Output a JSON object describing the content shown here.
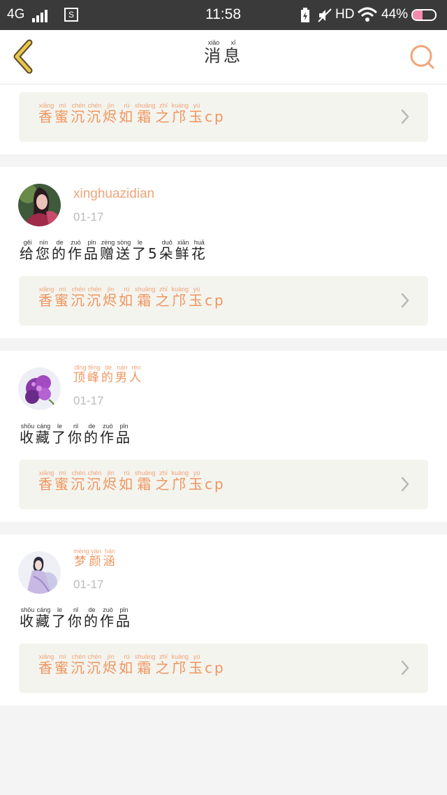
{
  "status_bar": {
    "network": "4G",
    "time": "11:58",
    "hd": "HD",
    "battery_text": "44%",
    "battery_level": 0.44
  },
  "header": {
    "title": [
      {
        "c": "消",
        "p": "xiāo"
      },
      {
        "c": "息",
        "p": "xī"
      }
    ],
    "back_icon": "chevron-left-icon",
    "search_icon": "search-icon",
    "accent_color": "#f0a478"
  },
  "colors": {
    "accent": "#f0a478",
    "work_text": "#f0955d",
    "work_bg": "#f4f4ef",
    "divider_bg": "#f4f4f4"
  },
  "messages": [
    {
      "username": "xinghuazidian",
      "username_ruby": null,
      "date": "01-17",
      "action": [
        {
          "c": "给",
          "p": "gěi"
        },
        {
          "c": "您",
          "p": "nín"
        },
        {
          "c": "的",
          "p": "de"
        },
        {
          "c": "作",
          "p": "zuò"
        },
        {
          "c": "品",
          "p": "pǐn"
        },
        {
          "c": "赠",
          "p": "zèng"
        },
        {
          "c": "送",
          "p": "sòng"
        },
        {
          "c": "了",
          "p": "le"
        },
        {
          "c": "5",
          "p": ""
        },
        {
          "c": "朵",
          "p": "duǒ"
        },
        {
          "c": "鲜",
          "p": "xiān"
        },
        {
          "c": "花",
          "p": "huā"
        }
      ],
      "work_title": [
        {
          "c": "香",
          "p": "xiāng"
        },
        {
          "c": "蜜",
          "p": "mì"
        },
        {
          "c": "沉",
          "p": "chén"
        },
        {
          "c": "沉",
          "p": "chén"
        },
        {
          "c": "烬",
          "p": "jìn"
        },
        {
          "c": "如",
          "p": "rú"
        },
        {
          "c": "霜",
          "p": "shuāng"
        },
        {
          "c": "之",
          "p": "zhī"
        },
        {
          "c": "邝",
          "p": "kuàng"
        },
        {
          "c": "玉",
          "p": "yù"
        },
        {
          "c": "cp",
          "p": ""
        }
      ],
      "avatar": "female-warrior"
    },
    {
      "username": "xinghuazidian",
      "username_ruby": null,
      "date": "01-17",
      "action": [
        {
          "c": "给",
          "p": "gěi"
        },
        {
          "c": "您",
          "p": "nín"
        },
        {
          "c": "的",
          "p": "de"
        },
        {
          "c": "作",
          "p": "zuò"
        },
        {
          "c": "品",
          "p": "pǐn"
        },
        {
          "c": "赠",
          "p": "zèng"
        },
        {
          "c": "送",
          "p": "sòng"
        },
        {
          "c": "了",
          "p": "le"
        },
        {
          "c": "5",
          "p": ""
        },
        {
          "c": "朵",
          "p": "duǒ"
        },
        {
          "c": "鲜",
          "p": "xiān"
        },
        {
          "c": "花",
          "p": "huā"
        }
      ],
      "work_title": [
        {
          "c": "香",
          "p": "xiāng"
        },
        {
          "c": "蜜",
          "p": "mì"
        },
        {
          "c": "沉",
          "p": "chén"
        },
        {
          "c": "沉",
          "p": "chén"
        },
        {
          "c": "烬",
          "p": "jìn"
        },
        {
          "c": "如",
          "p": "rú"
        },
        {
          "c": "霜",
          "p": "shuāng"
        },
        {
          "c": "之",
          "p": "zhī"
        },
        {
          "c": "邝",
          "p": "kuàng"
        },
        {
          "c": "玉",
          "p": "yù"
        },
        {
          "c": "cp",
          "p": ""
        }
      ],
      "avatar": "female-warrior"
    },
    {
      "username": "",
      "username_ruby": [
        {
          "c": "顶",
          "p": "dǐng"
        },
        {
          "c": "峰",
          "p": "fēng"
        },
        {
          "c": "的",
          "p": "de"
        },
        {
          "c": "男",
          "p": "nán"
        },
        {
          "c": "人",
          "p": "rén"
        }
      ],
      "date": "01-17",
      "action": [
        {
          "c": "收",
          "p": "shōu"
        },
        {
          "c": "藏",
          "p": "cáng"
        },
        {
          "c": "了",
          "p": "le"
        },
        {
          "c": "你",
          "p": "nǐ"
        },
        {
          "c": "的",
          "p": "de"
        },
        {
          "c": "作",
          "p": "zuò"
        },
        {
          "c": "品",
          "p": "pǐn"
        }
      ],
      "work_title": [
        {
          "c": "香",
          "p": "xiāng"
        },
        {
          "c": "蜜",
          "p": "mì"
        },
        {
          "c": "沉",
          "p": "chén"
        },
        {
          "c": "沉",
          "p": "chén"
        },
        {
          "c": "烬",
          "p": "jìn"
        },
        {
          "c": "如",
          "p": "rú"
        },
        {
          "c": "霜",
          "p": "shuāng"
        },
        {
          "c": "之",
          "p": "zhī"
        },
        {
          "c": "邝",
          "p": "kuàng"
        },
        {
          "c": "玉",
          "p": "yù"
        },
        {
          "c": "cp",
          "p": ""
        }
      ],
      "avatar": "purple-flowers"
    },
    {
      "username": "",
      "username_ruby": [
        {
          "c": "梦",
          "p": "mèng"
        },
        {
          "c": "颜",
          "p": "yán"
        },
        {
          "c": "涵",
          "p": "hán"
        }
      ],
      "date": "01-17",
      "action": [
        {
          "c": "收",
          "p": "shōu"
        },
        {
          "c": "藏",
          "p": "cáng"
        },
        {
          "c": "了",
          "p": "le"
        },
        {
          "c": "你",
          "p": "nǐ"
        },
        {
          "c": "的",
          "p": "de"
        },
        {
          "c": "作",
          "p": "zuò"
        },
        {
          "c": "品",
          "p": "pǐn"
        }
      ],
      "work_title": [
        {
          "c": "香",
          "p": "xiāng"
        },
        {
          "c": "蜜",
          "p": "mì"
        },
        {
          "c": "沉",
          "p": "chén"
        },
        {
          "c": "沉",
          "p": "chén"
        },
        {
          "c": "烬",
          "p": "jìn"
        },
        {
          "c": "如",
          "p": "rú"
        },
        {
          "c": "霜",
          "p": "shuāng"
        },
        {
          "c": "之",
          "p": "zhī"
        },
        {
          "c": "邝",
          "p": "kuàng"
        },
        {
          "c": "玉",
          "p": "yù"
        },
        {
          "c": "cp",
          "p": ""
        }
      ],
      "avatar": "fairy-lady"
    }
  ]
}
